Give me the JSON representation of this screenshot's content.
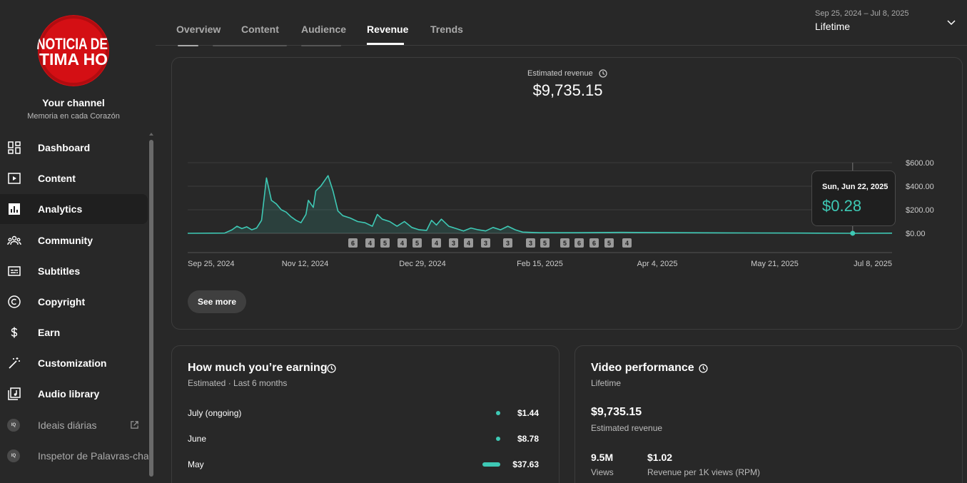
{
  "channel": {
    "logo_text_top": "NOTICIA DE",
    "logo_text_bottom": "TIMA HO",
    "name": "Your channel",
    "handle": "Memoria en cada Corazón"
  },
  "sidebar": {
    "items": [
      {
        "label": "Dashboard",
        "icon": "dashboard-icon"
      },
      {
        "label": "Content",
        "icon": "content-icon"
      },
      {
        "label": "Analytics",
        "icon": "analytics-icon",
        "active": true
      },
      {
        "label": "Community",
        "icon": "community-icon"
      },
      {
        "label": "Subtitles",
        "icon": "subtitles-icon"
      },
      {
        "label": "Copyright",
        "icon": "copyright-icon"
      },
      {
        "label": "Earn",
        "icon": "dollar-icon"
      },
      {
        "label": "Customization",
        "icon": "magic-wand-icon"
      },
      {
        "label": "Audio library",
        "icon": "audio-library-icon"
      },
      {
        "label": "Ideais diárias",
        "icon": "extension-icon",
        "badge": "IQ"
      },
      {
        "label": "Inspetor de Palavras-chav",
        "icon": "extension-icon",
        "badge": "IQ"
      }
    ]
  },
  "tabs": [
    {
      "label": "Overview"
    },
    {
      "label": "Content"
    },
    {
      "label": "Audience"
    },
    {
      "label": "Revenue",
      "active": true
    },
    {
      "label": "Trends"
    }
  ],
  "date_picker": {
    "range": "Sep 25, 2024 – Jul 8, 2025",
    "mode": "Lifetime"
  },
  "revenue_card": {
    "label": "Estimated revenue",
    "value": "$9,735.15",
    "see_more": "See more",
    "tooltip": {
      "date": "Sun, Jun 22, 2025",
      "value": "$0.28"
    }
  },
  "chart_data": {
    "type": "area",
    "title": "Estimated revenue",
    "x_tick_labels": [
      "Sep 25, 2024",
      "Nov 12, 2024",
      "Dec 29, 2024",
      "Feb 15, 2025",
      "Apr 4, 2025",
      "May 21, 2025",
      "Jul 8, 2025"
    ],
    "y_tick_labels": [
      "$0.00",
      "$200.00",
      "$400.00",
      "$600.00"
    ],
    "ylim": [
      0,
      600
    ],
    "grid": true,
    "x_start": "2024-09-25",
    "x_end": "2025-07-08",
    "series": [
      {
        "values": [
          {
            "date": "2024-09-25",
            "value": 0
          },
          {
            "date": "2024-10-10",
            "value": 2
          },
          {
            "date": "2024-10-13",
            "value": 30
          },
          {
            "date": "2024-10-15",
            "value": 60
          },
          {
            "date": "2024-10-17",
            "value": 40
          },
          {
            "date": "2024-10-19",
            "value": 55
          },
          {
            "date": "2024-10-21",
            "value": 30
          },
          {
            "date": "2024-10-23",
            "value": 45
          },
          {
            "date": "2024-10-25",
            "value": 110
          },
          {
            "date": "2024-10-27",
            "value": 470
          },
          {
            "date": "2024-10-29",
            "value": 280
          },
          {
            "date": "2024-10-31",
            "value": 250
          },
          {
            "date": "2024-11-02",
            "value": 200
          },
          {
            "date": "2024-11-04",
            "value": 180
          },
          {
            "date": "2024-11-06",
            "value": 140
          },
          {
            "date": "2024-11-08",
            "value": 110
          },
          {
            "date": "2024-11-10",
            "value": 90
          },
          {
            "date": "2024-11-12",
            "value": 160
          },
          {
            "date": "2024-11-13",
            "value": 280
          },
          {
            "date": "2024-11-15",
            "value": 220
          },
          {
            "date": "2024-11-16",
            "value": 360
          },
          {
            "date": "2024-11-18",
            "value": 400
          },
          {
            "date": "2024-11-20",
            "value": 460
          },
          {
            "date": "2024-11-21",
            "value": 490
          },
          {
            "date": "2024-11-23",
            "value": 360
          },
          {
            "date": "2024-11-25",
            "value": 190
          },
          {
            "date": "2024-11-27",
            "value": 150
          },
          {
            "date": "2024-11-30",
            "value": 130
          },
          {
            "date": "2024-12-03",
            "value": 100
          },
          {
            "date": "2024-12-06",
            "value": 90
          },
          {
            "date": "2024-12-09",
            "value": 60
          },
          {
            "date": "2024-12-11",
            "value": 160
          },
          {
            "date": "2024-12-13",
            "value": 120
          },
          {
            "date": "2024-12-16",
            "value": 100
          },
          {
            "date": "2024-12-19",
            "value": 60
          },
          {
            "date": "2024-12-22",
            "value": 100
          },
          {
            "date": "2024-12-25",
            "value": 50
          },
          {
            "date": "2024-12-28",
            "value": 30
          },
          {
            "date": "2024-12-31",
            "value": 25
          },
          {
            "date": "2025-01-02",
            "value": 110
          },
          {
            "date": "2025-01-04",
            "value": 70
          },
          {
            "date": "2025-01-06",
            "value": 120
          },
          {
            "date": "2025-01-09",
            "value": 60
          },
          {
            "date": "2025-01-12",
            "value": 40
          },
          {
            "date": "2025-01-15",
            "value": 20
          },
          {
            "date": "2025-01-18",
            "value": 45
          },
          {
            "date": "2025-01-21",
            "value": 30
          },
          {
            "date": "2025-01-24",
            "value": 20
          },
          {
            "date": "2025-01-27",
            "value": 50
          },
          {
            "date": "2025-01-30",
            "value": 30
          },
          {
            "date": "2025-02-02",
            "value": 60
          },
          {
            "date": "2025-02-05",
            "value": 30
          },
          {
            "date": "2025-02-08",
            "value": 10
          },
          {
            "date": "2025-02-15",
            "value": 5
          },
          {
            "date": "2025-03-01",
            "value": 5
          },
          {
            "date": "2025-03-20",
            "value": 8
          },
          {
            "date": "2025-04-15",
            "value": 5
          },
          {
            "date": "2025-05-10",
            "value": 3
          },
          {
            "date": "2025-06-01",
            "value": 2
          },
          {
            "date": "2025-06-22",
            "value": 0.28
          },
          {
            "date": "2025-07-08",
            "value": 1
          }
        ]
      }
    ],
    "markers": [
      "6",
      "4",
      "5",
      "4",
      "5",
      "4",
      "3",
      "4",
      "3",
      "3",
      "3",
      "5",
      "5",
      "6",
      "6",
      "5",
      "4"
    ],
    "line_color": "#3ec9b5"
  },
  "earning_card": {
    "title": "How much you’re earning",
    "subtitle": "Estimated · Last 6 months",
    "rows": [
      {
        "month": "July (ongoing)",
        "value": "$1.44",
        "fraction": 0.04
      },
      {
        "month": "June",
        "value": "$8.78",
        "fraction": 0.04
      },
      {
        "month": "May",
        "value": "$37.63",
        "fraction": 0.5
      }
    ]
  },
  "video_card": {
    "title": "Video performance",
    "subtitle": "Lifetime",
    "revenue_value": "$9,735.15",
    "revenue_label": "Estimated revenue",
    "views_value": "9.5M",
    "views_label": "Views",
    "rpm_value": "$1.02",
    "rpm_label": "Revenue per 1K views (RPM)"
  },
  "colors": {
    "accent": "#3ec9b5",
    "background": "#282828",
    "logo_red": "#d40f14"
  }
}
